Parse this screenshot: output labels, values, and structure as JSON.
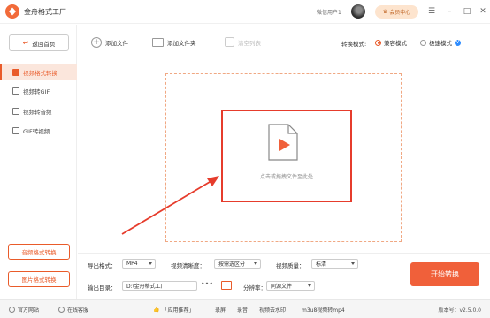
{
  "app": {
    "title": "金舟格式工厂",
    "user_name": "微信用户1",
    "vip_label": "会员中心"
  },
  "sidebar": {
    "home_label": "返回首页",
    "items": [
      {
        "label": "视频格式转换",
        "active": true
      },
      {
        "label": "视频转GIF",
        "active": false
      },
      {
        "label": "视频转音频",
        "active": false
      },
      {
        "label": "GIF转视频",
        "active": false
      }
    ],
    "bottom_buttons": [
      "音频格式转换",
      "图片格式转换"
    ]
  },
  "toolbar": {
    "add_file": "添加文件",
    "add_folder": "添加文件夹",
    "clear_list": "清空列表",
    "mode_label": "转换模式:",
    "mode_compatible": "兼容模式",
    "mode_fast": "极速模式",
    "vip_badge": "V"
  },
  "drop_zone": {
    "hint": "点击或拖拽文件至此处"
  },
  "settings": {
    "export_format_label": "导出格式：",
    "export_format_value": "MP4",
    "clarity_label": "视频清晰度：",
    "clarity_value": "按需选区分",
    "quality_label": "视频质量：",
    "quality_value": "标清",
    "output_label": "输出目录：",
    "output_value": "D:\\金舟格式工厂",
    "dots": "•••",
    "resolution_label": "分辨率：",
    "resolution_value": "同源文件",
    "start_button": "开始转换"
  },
  "footer": {
    "website": "官方网站",
    "support": "在线客服",
    "recommend": "「应用推荐」",
    "links": [
      "录屏",
      "录音",
      "视频去水印",
      "m3u8视频转mp4"
    ],
    "version_label": "版本号：",
    "version_value": "v2.5.0.0"
  },
  "colors": {
    "accent": "#e95b2a",
    "highlight_box": "#e63c2c",
    "start_button": "#f0603a"
  }
}
